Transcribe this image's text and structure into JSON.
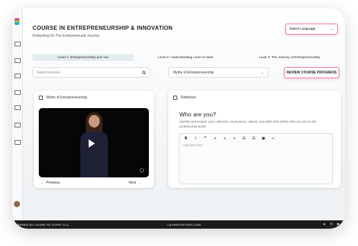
{
  "header": {
    "title": "COURSE IN ENTREPRENEURSHIP & INNOVATION",
    "subtitle": "Embarking On The Entrepreneurial Journey",
    "language_select": "Select Language"
  },
  "levels": [
    {
      "label": "Level 1: Entrepreneurship and You",
      "active": true
    },
    {
      "label": "Level 2: Understanding Learn to Start",
      "active": false
    },
    {
      "label": "Level 3: The Journey of Entrepreneurship",
      "active": false
    }
  ],
  "controls": {
    "search_placeholder": "Search lessons",
    "lesson_select": "Myths of Entrepreneurship",
    "review_button": "REVIEW COURSE PROGRESS"
  },
  "video_card": {
    "header": "Myths of Entrepreneurship",
    "previous": "Previous",
    "next": "Next"
  },
  "reflection_card": {
    "header": "Reflection",
    "question": "Who are you?",
    "description": "Identify and explain your collection of passions, values, and skills that define who you are to the professional world.",
    "toolbar": [
      "B",
      "I",
      "❞",
      "≡",
      "≡",
      "≡",
      "☰",
      "☰",
      "▣",
      "∞"
    ],
    "editor_placeholder": "Add text here..."
  },
  "footer": {
    "left": "OWERED BY LEARN TO START LLC",
    "center": "LEARNTOSTART.COM",
    "icons": [
      "globe-icon",
      "x-icon",
      "linkedin-icon"
    ]
  },
  "colors": {
    "accent": "#e97a9c",
    "active_tab": "#e3edf1",
    "footer_bg": "#1b1b1b"
  }
}
